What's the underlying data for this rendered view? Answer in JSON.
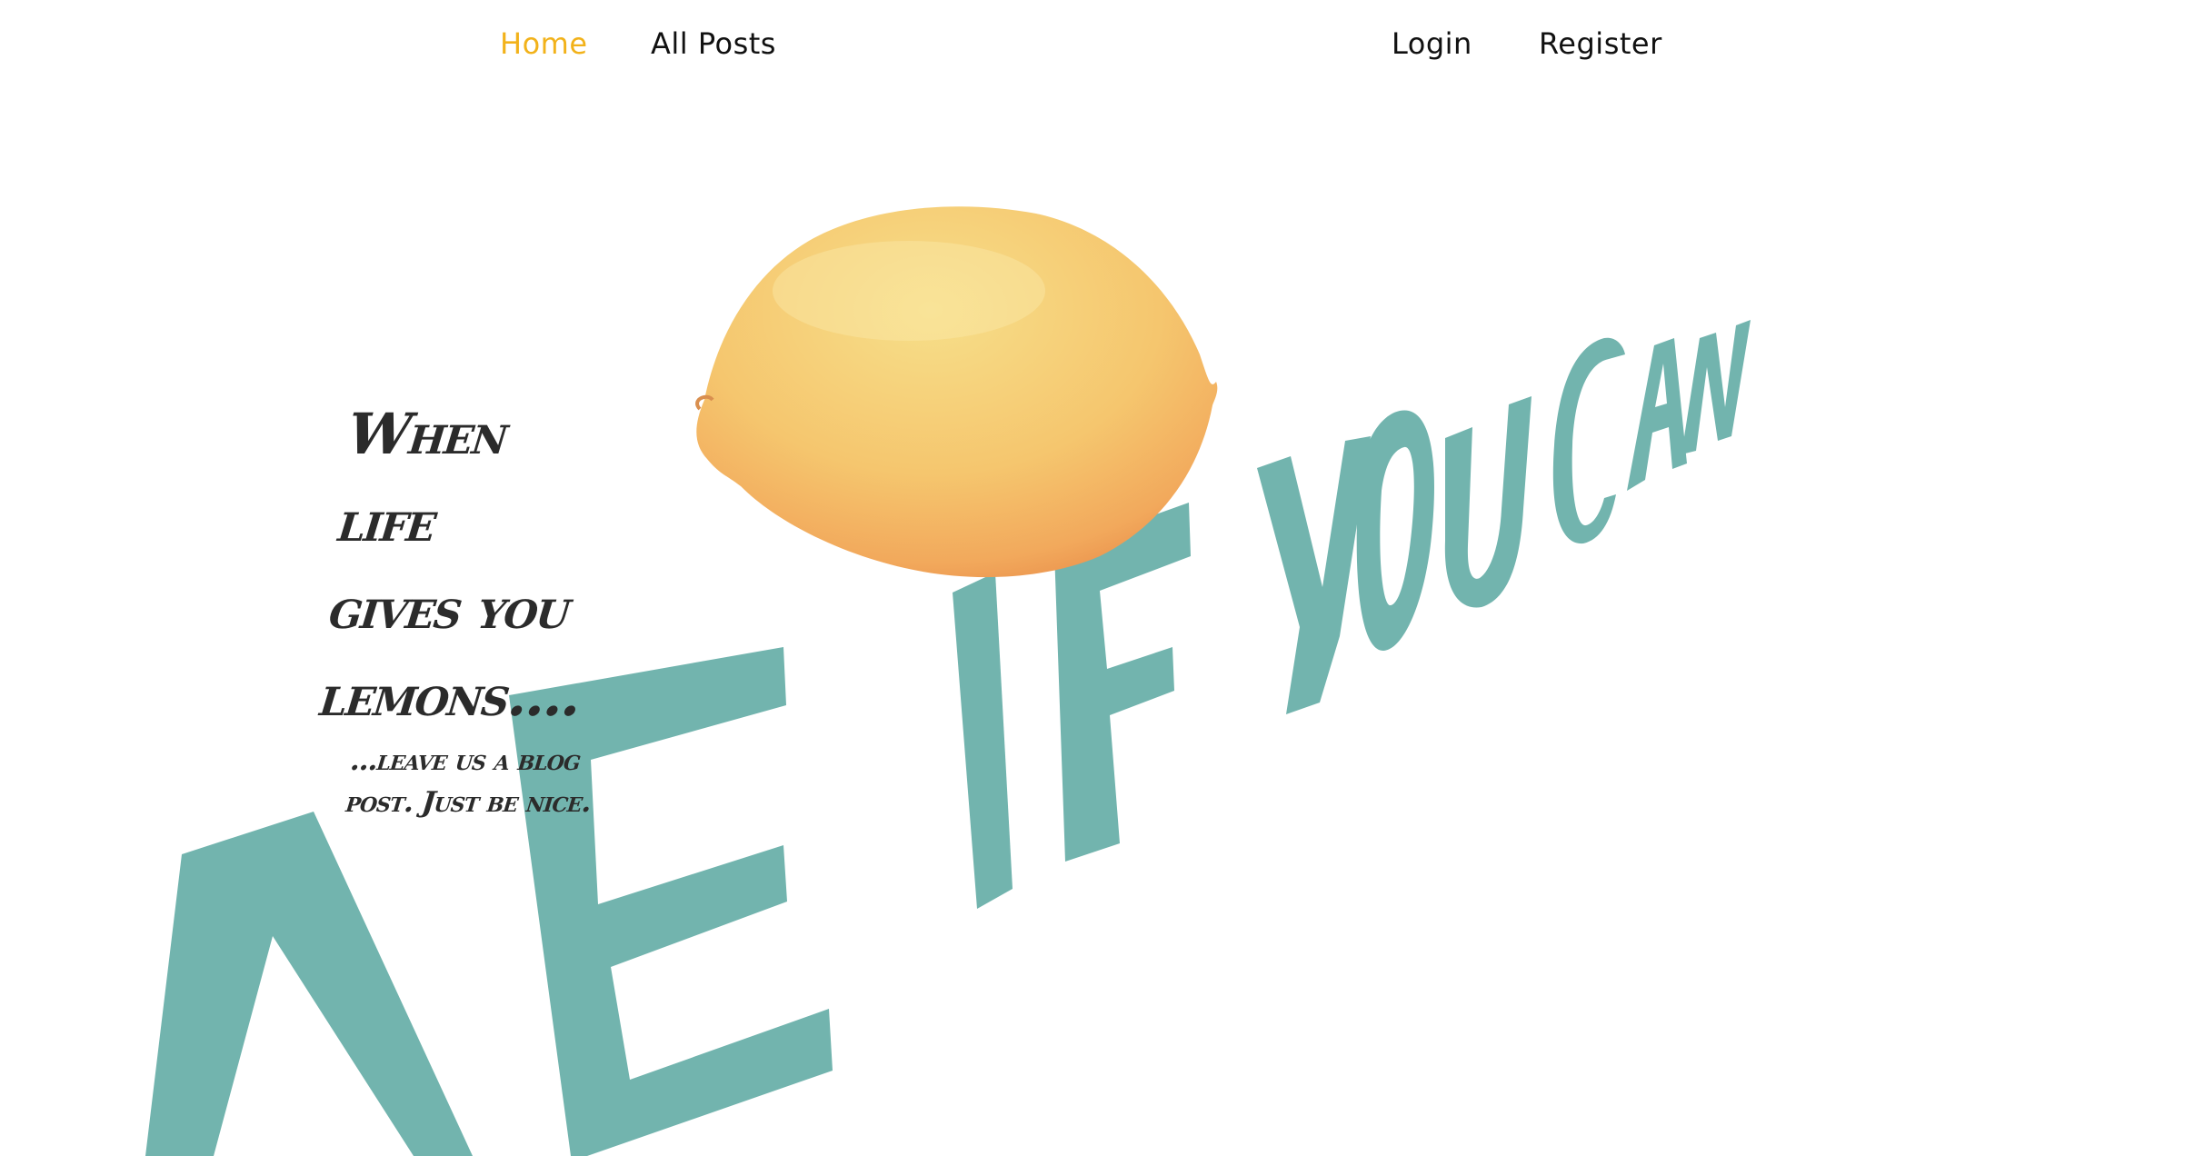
{
  "nav": {
    "home": "Home",
    "all_posts": "All Posts",
    "login": "Login",
    "register": "Register",
    "active_color": "#f2b21a"
  },
  "hero": {
    "headline_lines": [
      "When",
      "life",
      "gives you",
      "lemons...."
    ],
    "subline": "...leave us a blog post. Just be nice.",
    "art_text_icon": "make-lemonade-if-you-can-art",
    "art_color": "#72b4ae",
    "lemon_icon": "lemon-image"
  }
}
